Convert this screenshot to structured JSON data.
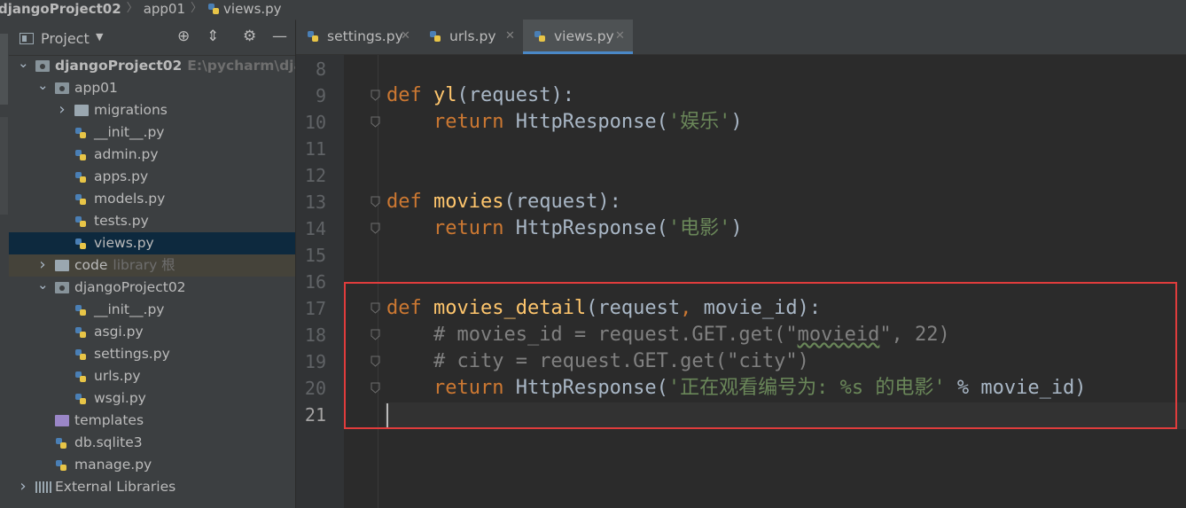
{
  "breadcrumb": {
    "root": "djangoProject02",
    "folder": "app01",
    "file": "views.py"
  },
  "project_panel": {
    "title": "Project",
    "tree": [
      {
        "label": "djangoProject02",
        "hint": "E:\\pycharm\\django",
        "level": 0,
        "type": "module",
        "expanded": true,
        "bold": true
      },
      {
        "label": "app01",
        "level": 1,
        "type": "module",
        "expanded": true
      },
      {
        "label": "migrations",
        "level": 2,
        "type": "folder",
        "expanded": false
      },
      {
        "label": "__init__.py",
        "level": 2,
        "type": "python"
      },
      {
        "label": "admin.py",
        "level": 2,
        "type": "python"
      },
      {
        "label": "apps.py",
        "level": 2,
        "type": "python"
      },
      {
        "label": "models.py",
        "level": 2,
        "type": "python"
      },
      {
        "label": "tests.py",
        "level": 2,
        "type": "python"
      },
      {
        "label": "views.py",
        "level": 2,
        "type": "python",
        "selected": true
      },
      {
        "label": "code",
        "hint": "library 根",
        "level": 1,
        "type": "folder",
        "expanded": false,
        "library": true
      },
      {
        "label": "djangoProject02",
        "level": 1,
        "type": "module",
        "expanded": true
      },
      {
        "label": "__init__.py",
        "level": 2,
        "type": "python"
      },
      {
        "label": "asgi.py",
        "level": 2,
        "type": "python"
      },
      {
        "label": "settings.py",
        "level": 2,
        "type": "python"
      },
      {
        "label": "urls.py",
        "level": 2,
        "type": "python"
      },
      {
        "label": "wsgi.py",
        "level": 2,
        "type": "python"
      },
      {
        "label": "templates",
        "level": 1,
        "type": "template"
      },
      {
        "label": "db.sqlite3",
        "level": 1,
        "type": "db"
      },
      {
        "label": "manage.py",
        "level": 1,
        "type": "python"
      },
      {
        "label": "External Libraries",
        "level": 0,
        "type": "library",
        "expanded": false
      }
    ]
  },
  "tabs": [
    {
      "label": "settings.py",
      "active": false
    },
    {
      "label": "urls.py",
      "active": false
    },
    {
      "label": "views.py",
      "active": true
    }
  ],
  "editor": {
    "current_line": 21,
    "lines": [
      {
        "num": "8",
        "tokens": []
      },
      {
        "num": "9",
        "tokens": [
          [
            "kw",
            "def "
          ],
          [
            "fn",
            "yl"
          ],
          [
            "p",
            "(request):"
          ]
        ]
      },
      {
        "num": "10",
        "tokens": [
          [
            "p",
            "    "
          ],
          [
            "kw",
            "return "
          ],
          [
            "p",
            "HttpResponse("
          ],
          [
            "str",
            "'娱乐'"
          ],
          [
            "p",
            ")"
          ]
        ]
      },
      {
        "num": "11",
        "tokens": []
      },
      {
        "num": "12",
        "tokens": []
      },
      {
        "num": "13",
        "tokens": [
          [
            "kw",
            "def "
          ],
          [
            "fn",
            "movies"
          ],
          [
            "p",
            "(request):"
          ]
        ]
      },
      {
        "num": "14",
        "tokens": [
          [
            "p",
            "    "
          ],
          [
            "kw",
            "return "
          ],
          [
            "p",
            "HttpResponse("
          ],
          [
            "str",
            "'电影'"
          ],
          [
            "p",
            ")"
          ]
        ]
      },
      {
        "num": "15",
        "tokens": []
      },
      {
        "num": "16",
        "tokens": []
      },
      {
        "num": "17",
        "tokens": [
          [
            "kw",
            "def "
          ],
          [
            "fn",
            "movies_detail"
          ],
          [
            "p",
            "(request"
          ],
          [
            "kw",
            ", "
          ],
          [
            "p",
            "movie_id):"
          ]
        ]
      },
      {
        "num": "18",
        "tokens": [
          [
            "p",
            "    "
          ],
          [
            "cm",
            "# movies_id = request.GET.get(\""
          ],
          [
            "cmu",
            "movieid"
          ],
          [
            "cm",
            "\", 22)"
          ]
        ]
      },
      {
        "num": "19",
        "tokens": [
          [
            "p",
            "    "
          ],
          [
            "cm",
            "# city = request.GET.get(\"city\")"
          ]
        ]
      },
      {
        "num": "20",
        "tokens": [
          [
            "p",
            "    "
          ],
          [
            "kw",
            "return "
          ],
          [
            "p",
            "HttpResponse("
          ],
          [
            "str",
            "'正在观看编号为: %s 的电影'"
          ],
          [
            "p",
            " % movie_id)"
          ]
        ]
      },
      {
        "num": "21",
        "tokens": []
      }
    ]
  },
  "colors": {
    "keyword": "#cc7832",
    "function": "#ffc66d",
    "string": "#6a8759",
    "comment": "#808080",
    "text": "#a9b7c6",
    "highlight_box": "#e03c3c",
    "tab_underline": "#4a88c7"
  }
}
